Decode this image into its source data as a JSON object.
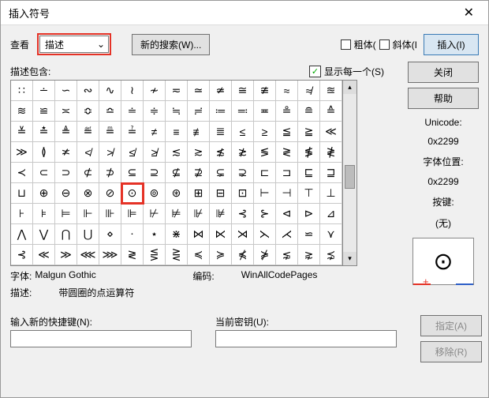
{
  "title": "插入符号",
  "close": "✕",
  "view_label": "查看",
  "view_combo": "描述",
  "search_btn": "新的搜索(W)...",
  "bold_label": "粗体(",
  "italic_label": "斜体(I",
  "insert_btn": "插入(I)",
  "desc_contains": "描述包含:",
  "show_each": "显示每一个(S)",
  "close_btn": "关闭",
  "help_btn": "帮助",
  "unicode_lbl": "Unicode:",
  "unicode_val": "0x2299",
  "fontpos_lbl": "字体位置:",
  "fontpos_val": "0x2299",
  "keys_lbl": "按键:",
  "keys_val": "(无)",
  "preview_sym": "⊙",
  "font_lbl": "字体:",
  "font_val": "Malgun Gothic",
  "enc_lbl": "编码:",
  "enc_val": "WinAllCodePages",
  "desc_lbl": "描述:",
  "desc_val": "带圆圈的点运算符",
  "shortcut_lbl": "输入新的快捷键(N):",
  "current_lbl": "当前密钥(U):",
  "assign_btn": "指定(A)",
  "remove_btn": "移除(R)",
  "grid": [
    [
      "∷",
      "∸",
      "∽",
      "∾",
      "∿",
      "≀",
      "≁",
      "≂",
      "≃",
      "≄",
      "≅",
      "≇",
      "≈",
      "≉",
      "≊"
    ],
    [
      "≋",
      "≌",
      "≍",
      "≎",
      "≏",
      "≐",
      "≑",
      "≒",
      "≓",
      "≔",
      "≕",
      "≖",
      "≗",
      "≘",
      "≙"
    ],
    [
      "≚",
      "≛",
      "≜",
      "≝",
      "≞",
      "≟",
      "≠",
      "≡",
      "≢",
      "≣",
      "≤",
      "≥",
      "≦",
      "≧",
      "≪"
    ],
    [
      "≫",
      "≬",
      "≭",
      "≮",
      "≯",
      "≰",
      "≱",
      "≲",
      "≳",
      "≴",
      "≵",
      "≶",
      "≷",
      "≸",
      "≹"
    ],
    [
      "≺",
      "⊂",
      "⊃",
      "⊄",
      "⊅",
      "⊆",
      "⊇",
      "⊈",
      "⊉",
      "⊊",
      "⊋",
      "⊏",
      "⊐",
      "⊑",
      "⊒"
    ],
    [
      "⊔",
      "⊕",
      "⊖",
      "⊗",
      "⊘",
      "⊙",
      "⊚",
      "⊛",
      "⊞",
      "⊟",
      "⊡",
      "⊢",
      "⊣",
      "⊤",
      "⊥"
    ],
    [
      "⊦",
      "⊧",
      "⊨",
      "⊩",
      "⊪",
      "⊫",
      "⊬",
      "⊭",
      "⊮",
      "⊯",
      "⊰",
      "⊱",
      "⊲",
      "⊳",
      "⊿"
    ],
    [
      "⋀",
      "⋁",
      "⋂",
      "⋃",
      "⋄",
      "⋅",
      "⋆",
      "⋇",
      "⋈",
      "⋉",
      "⋊",
      "⋋",
      "⋌",
      "⋍",
      "⋎"
    ],
    [
      "⊰",
      "≪",
      "≫",
      "⋘",
      "⋙",
      "≷",
      "⋚",
      "⋛",
      "≼",
      "≽",
      "⋠",
      "⋡",
      "⋦",
      "⋧",
      "⋨"
    ]
  ],
  "selected": {
    "row": 5,
    "col": 5
  }
}
